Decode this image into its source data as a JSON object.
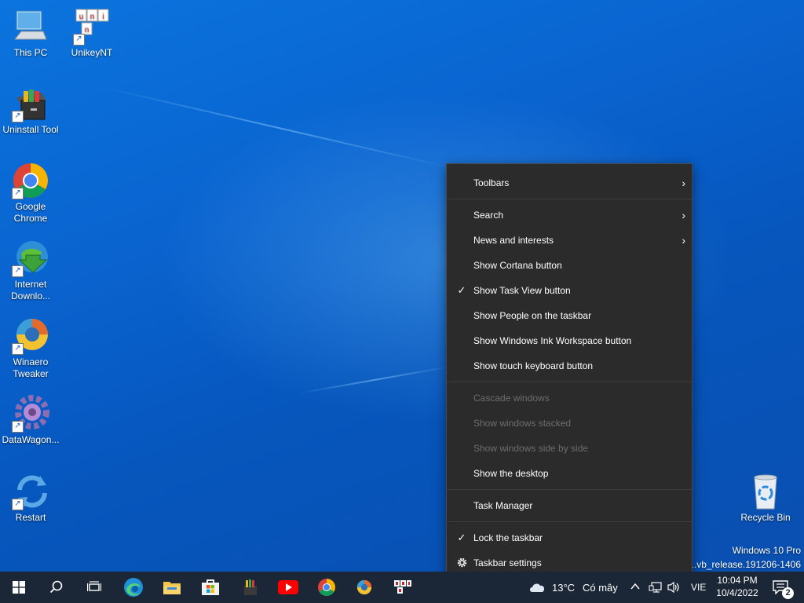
{
  "desktop": {
    "icons": [
      {
        "label": "This PC"
      },
      {
        "label": "UnikeyNT"
      },
      {
        "label": "Uninstall Tool"
      },
      {
        "label": "Google Chrome"
      },
      {
        "label": "Internet Downlo..."
      },
      {
        "label": "Winaero Tweaker"
      },
      {
        "label": "DataWagon..."
      },
      {
        "label": "Restart"
      },
      {
        "label": "Recycle Bin"
      }
    ],
    "watermark": {
      "line1": "Windows 10 Pro",
      "line2": "41.vb_release.191206-1406"
    }
  },
  "context_menu": {
    "items": [
      {
        "label": "Toolbars",
        "submenu": true
      },
      {
        "label": "Search",
        "submenu": true
      },
      {
        "label": "News and interests",
        "submenu": true
      },
      {
        "label": "Show Cortana button"
      },
      {
        "label": "Show Task View button",
        "checked": true
      },
      {
        "label": "Show People on the taskbar"
      },
      {
        "label": "Show Windows Ink Workspace button"
      },
      {
        "label": "Show touch keyboard button"
      },
      {
        "label": "Cascade windows",
        "disabled": true
      },
      {
        "label": "Show windows stacked",
        "disabled": true
      },
      {
        "label": "Show windows side by side",
        "disabled": true
      },
      {
        "label": "Show the desktop"
      },
      {
        "label": "Task Manager"
      },
      {
        "label": "Lock the taskbar",
        "checked": true
      },
      {
        "label": "Taskbar settings",
        "icon": "gear-icon"
      }
    ],
    "check_glyph": "✓",
    "arrow_glyph": "›"
  },
  "taskbar": {
    "weather": {
      "temp": "13°C",
      "condition": "Có mây"
    },
    "language": "VIE",
    "time": "10:04 PM",
    "date": "10/4/2022",
    "notification_count": "2"
  },
  "colors": {
    "menu_bg": "#2b2b2b",
    "taskbar_bg": "#1b2736",
    "disabled_text": "#6d6d6d"
  }
}
